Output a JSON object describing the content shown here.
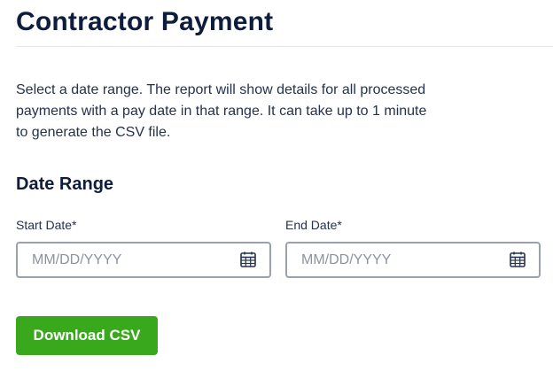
{
  "header": {
    "title": "Contractor Payment"
  },
  "description": "Select a date range. The report will show details for all processed payments with a pay date in that range. It can take up to 1 minute to generate the CSV file.",
  "date_range": {
    "section_title": "Date Range",
    "start": {
      "label": "Start Date*",
      "placeholder": "MM/DD/YYYY",
      "value": "",
      "icon": "calendar-icon"
    },
    "end": {
      "label": "End Date*",
      "placeholder": "MM/DD/YYYY",
      "value": "",
      "icon": "calendar-icon"
    }
  },
  "actions": {
    "download_label": "Download CSV",
    "download_color": "#3aa81c"
  }
}
